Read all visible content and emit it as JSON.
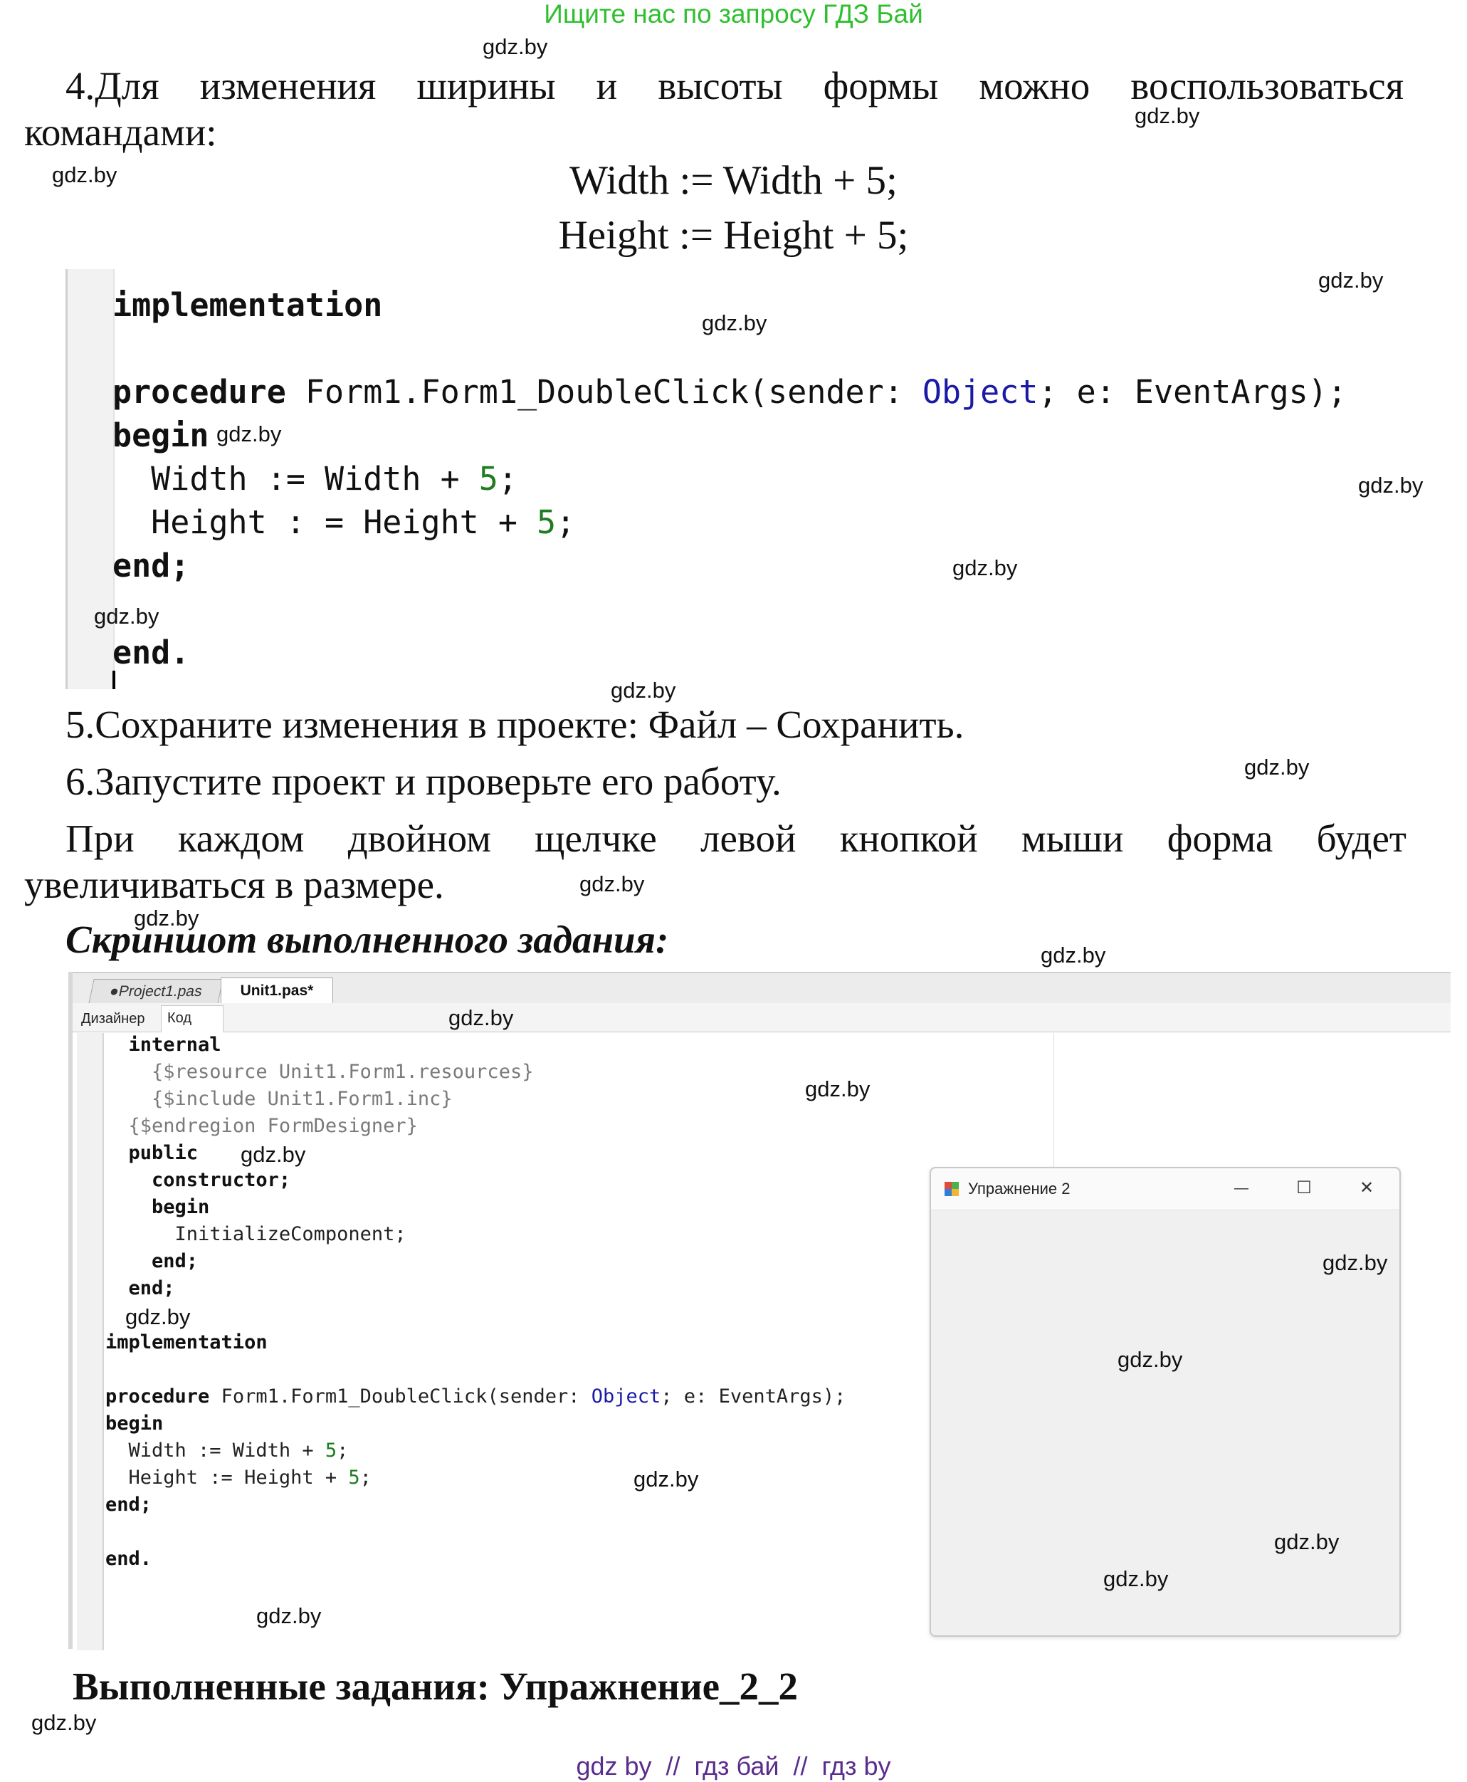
{
  "header": {
    "banner": "Ищите нас по запросу ГДЗ Бай"
  },
  "text": {
    "p4_line1": [
      "4.Для",
      "изменения",
      "ширины",
      "и",
      "высоты",
      "формы",
      "можно",
      "воспользоваться"
    ],
    "p4_line2": "командами:",
    "formula1": "Width := Width + 5;",
    "formula2": "Height := Height + 5;",
    "p5": "5.Сохраните изменения в проекте: Файл – Сохранить.",
    "p6": "6.Запустите проект и проверьте его работу.",
    "p7_line1": [
      "При",
      "каждом",
      "двойном",
      "щелчке",
      "левой",
      "кнопкой",
      "мыши",
      "форма",
      "будет"
    ],
    "p7_line2": "увеличиваться в размере.",
    "screenshot_heading": "Скриншот выполненного задания:",
    "footer_heading": "Выполненные задания: Упражнение_2_2",
    "footer_links": "gdz by  //  гдз бай  //  гдз by"
  },
  "code1": {
    "implementation": "implementation",
    "procedure_kw": "procedure",
    "procedure_name": " Form1.Form1_DoubleClick(sender: ",
    "object_type": "Object",
    "procedure_rest": "; e: EventArgs);",
    "begin": "begin",
    "width_a": "  Width := Width + ",
    "width_num": "5",
    "semicolon": ";",
    "height_a": "  Height : = Height + ",
    "height_num": "5",
    "end_semi": "end;",
    "end_dot": "end."
  },
  "ide": {
    "tabs": [
      "●Project1.pas",
      "Unit1.pas*"
    ],
    "subtabs": [
      "Дизайнер",
      "Код"
    ],
    "code": {
      "internal": "internal",
      "resource": "{$resource Unit1.Form1.resources}",
      "include": "{$include Unit1.Form1.inc}",
      "endregion": "{$endregion FormDesigner}",
      "public": "public",
      "constructor": "constructor;",
      "begin": "begin",
      "init": "InitializeComponent;",
      "end_semi": "end;",
      "implementation": "implementation",
      "procedure_kw": "procedure",
      "procedure_name": " Form1.Form1_DoubleClick(sender: ",
      "object_type": "Object",
      "procedure_rest": "; e: EventArgs);",
      "width_a": "  Width := Width + ",
      "height_a": "  Height := Height + ",
      "num": "5",
      "semicolon": ";",
      "end_dot": "end."
    },
    "window": {
      "title": "Упражнение 2",
      "minimize": "—",
      "maximize": "☐",
      "close": "✕"
    }
  },
  "watermark": "gdz.by",
  "colors": {
    "banner": "#2fbf2f",
    "keyword_blue": "#1a1aa6",
    "number_green": "#1e7d1e",
    "footer_links": "#5a2d8c"
  }
}
